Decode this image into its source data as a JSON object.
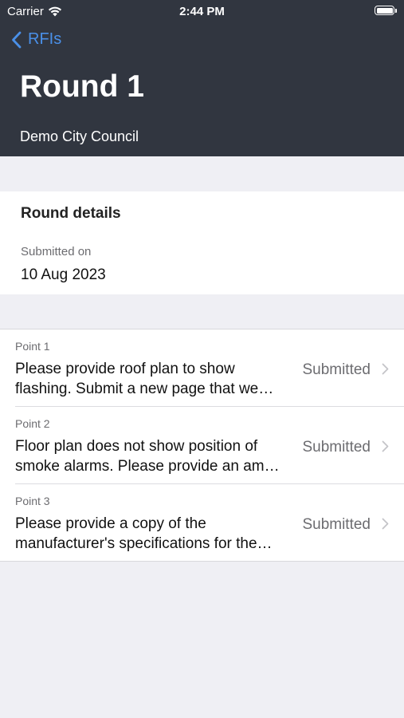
{
  "status_bar": {
    "carrier": "Carrier",
    "time": "2:44 PM"
  },
  "nav": {
    "back_label": "RFIs",
    "title": "Round 1",
    "subtitle": "Demo City Council"
  },
  "round_details": {
    "heading": "Round details",
    "submitted_label": "Submitted on",
    "submitted_date": "10 Aug 2023"
  },
  "points": [
    {
      "label": "Point 1",
      "line1": "Please provide roof plan to show",
      "line2": "flashing.  Submit a new page that we…",
      "status": "Submitted"
    },
    {
      "label": "Point 2",
      "line1": "Floor plan does not show position of",
      "line2": "smoke alarms.  Please provide an am…",
      "status": "Submitted"
    },
    {
      "label": "Point 3",
      "line1": "Please provide a copy of the",
      "line2": "manufacturer's specifications for the…",
      "status": "Submitted"
    }
  ],
  "colors": {
    "header_bg": "#313640",
    "accent": "#4a90e8",
    "page_bg": "#efeff4"
  }
}
